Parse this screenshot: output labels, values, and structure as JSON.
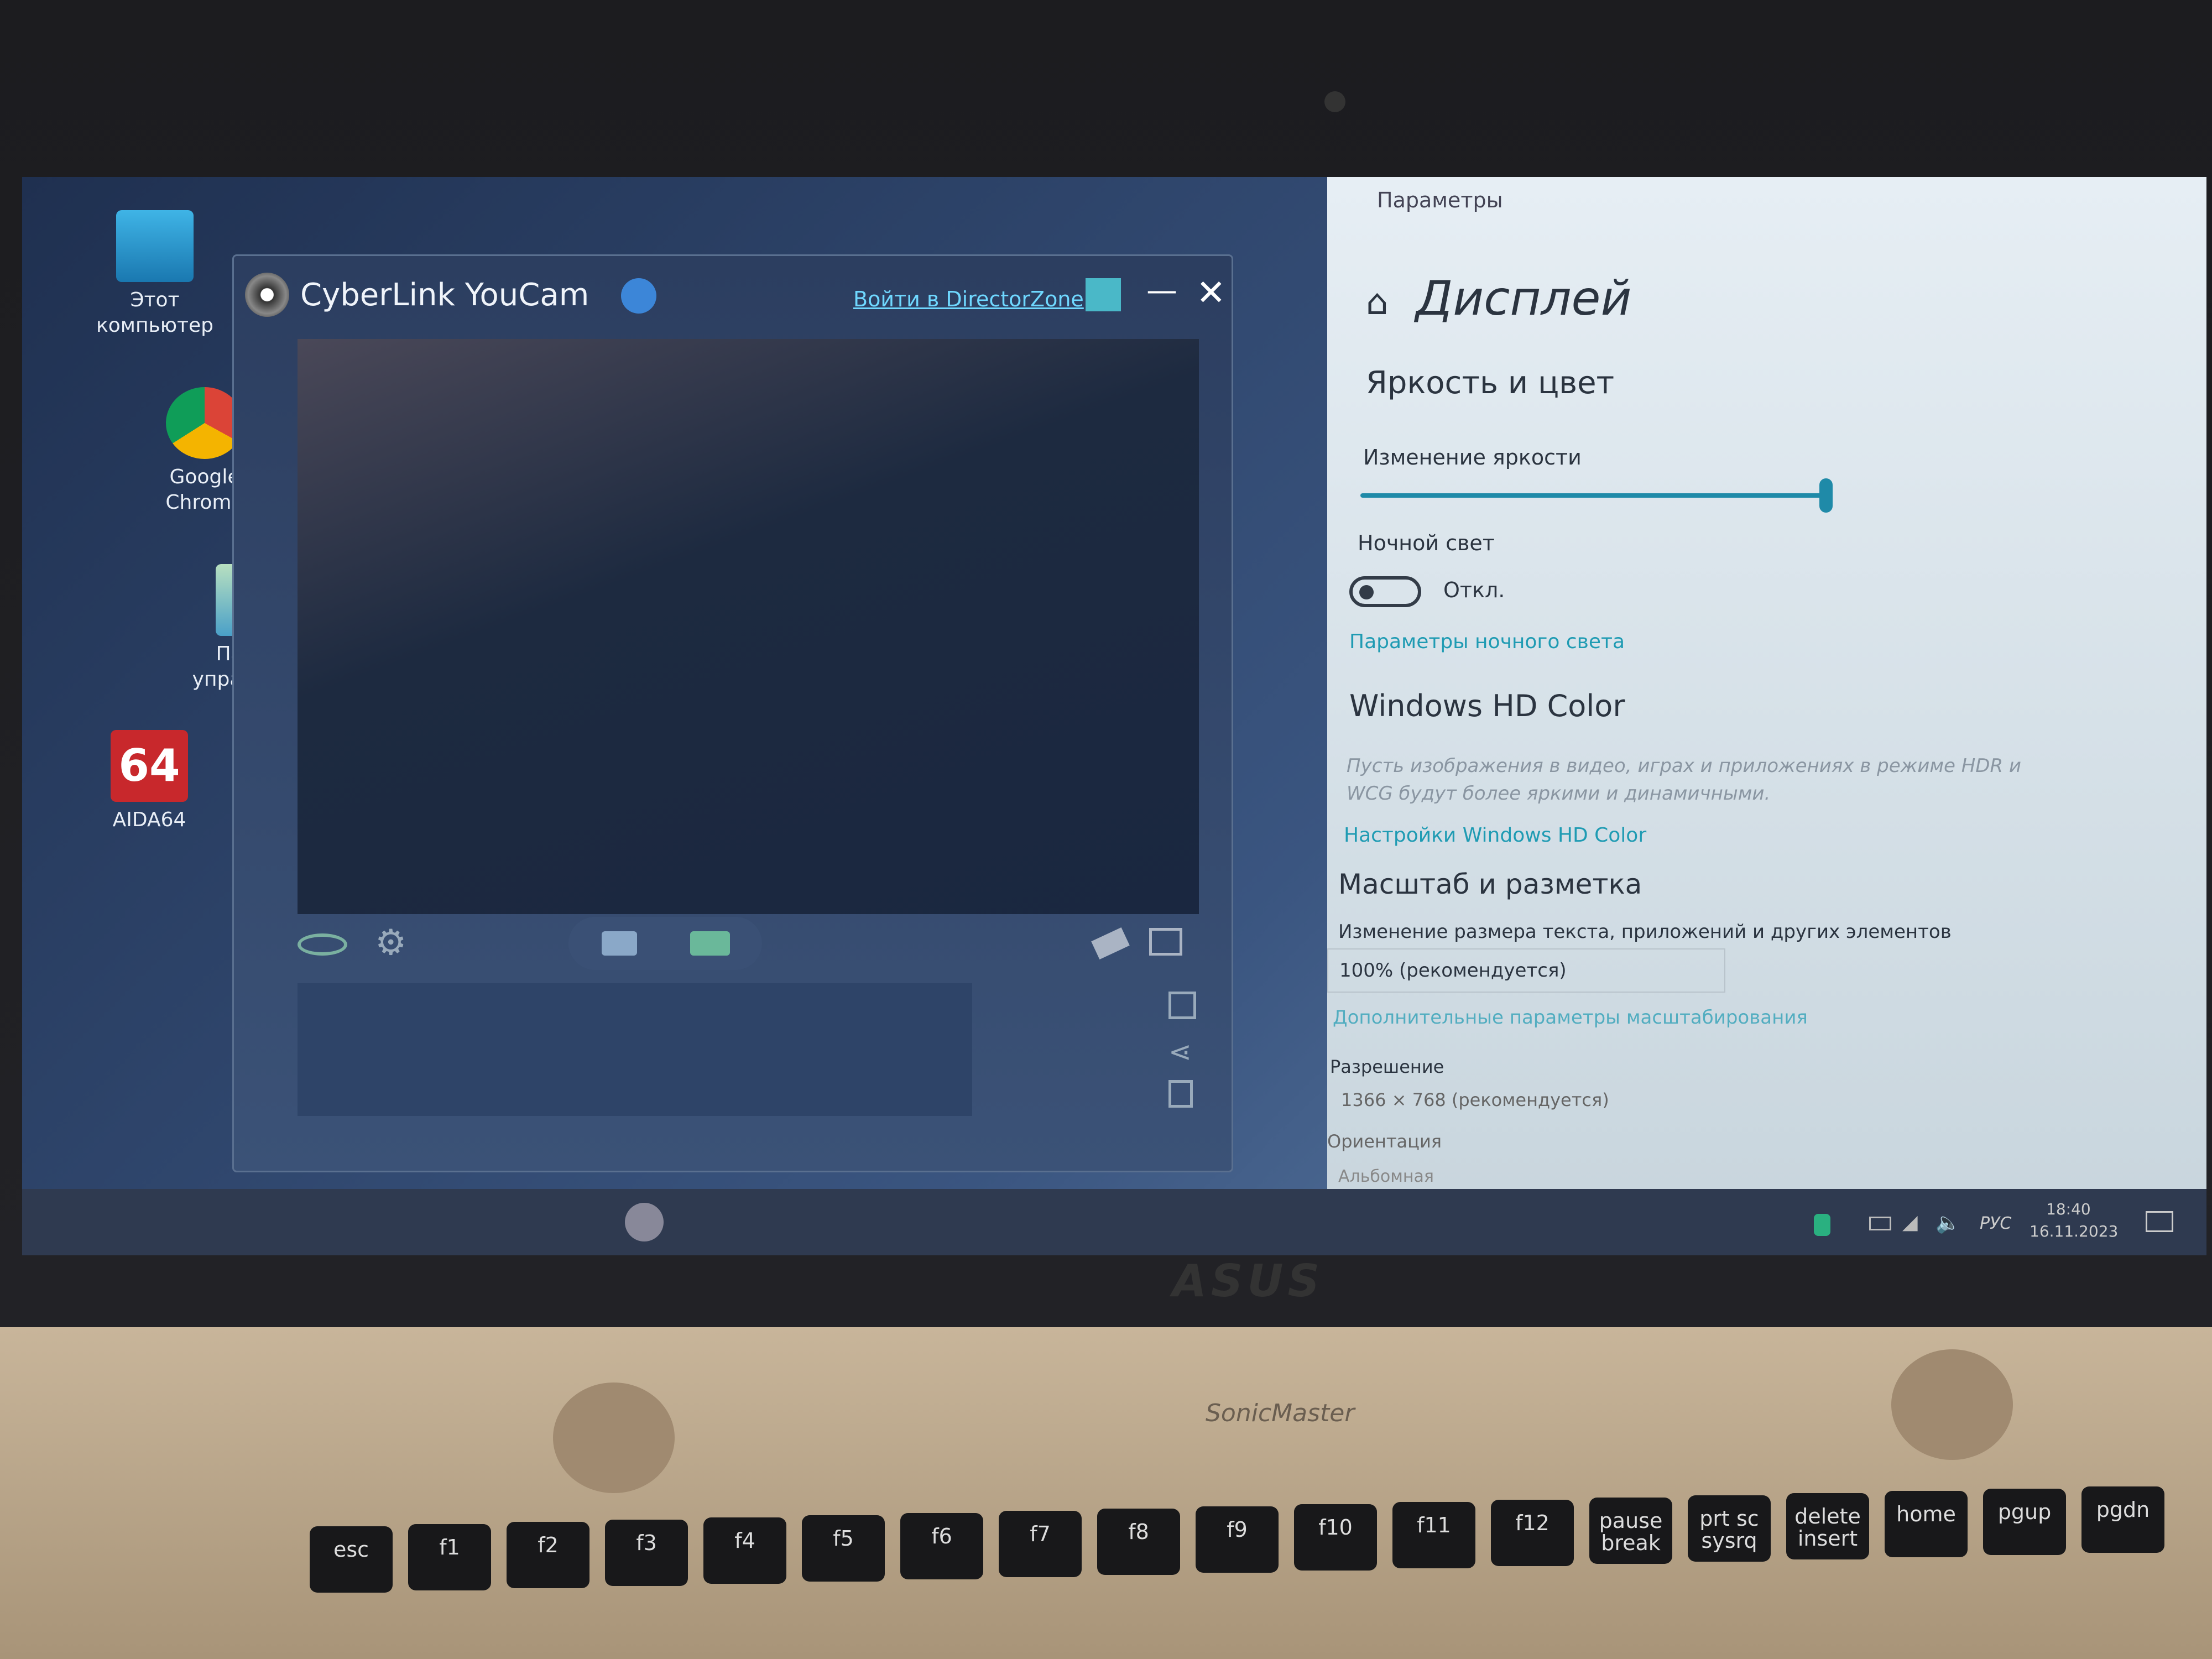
{
  "desktop": {
    "icons": [
      {
        "label": "Этот компьютер",
        "icon": "monitor-icon"
      },
      {
        "label": "Google Chrome",
        "icon": "chrome-icon"
      },
      {
        "label": "Панель управления",
        "icon": "control-panel-icon"
      },
      {
        "label": "AIDA64",
        "icon": "aida64-icon"
      }
    ]
  },
  "youcam": {
    "title": "CyberLink YouCam",
    "login_link": "Войти в DirectorZone",
    "minimize": "—",
    "close": "✕"
  },
  "settings": {
    "window_title": "Параметры",
    "page_title": "Дисплей",
    "brightness_section": "Яркость и цвет",
    "brightness_label": "Изменение яркости",
    "brightness_percent": 100,
    "night_light_label": "Ночной свет",
    "night_light_state": "Откл.",
    "night_light_link": "Параметры ночного света",
    "hdr_title": "Windows HD Color",
    "hdr_desc": "Пусть изображения в видео, играх и приложениях в режиме HDR и WCG будут более яркими и динамичными.",
    "hdr_link": "Настройки Windows HD Color",
    "scale_section": "Масштаб и разметка",
    "scale_label": "Изменение размера текста, приложений и других элементов",
    "scale_value": "100% (рекомендуется)",
    "scale_link": "Дополнительные параметры масштабирования",
    "resolution_label": "Разрешение",
    "resolution_value": "1366 × 768 (рекомендуется)",
    "orientation_label": "Ориентация",
    "orientation_value": "Альбомная",
    "accent": "#1f9bb3"
  },
  "taskbar": {
    "language": "РУС",
    "time": "18:40",
    "date": "16.11.2023"
  },
  "laptop": {
    "brand": "ASUS",
    "speaker": "SonicMaster"
  },
  "keyboard": {
    "keys": [
      "esc",
      "f1",
      "f2",
      "f3",
      "f4",
      "f5",
      "f6",
      "f7",
      "f8",
      "f9",
      "f10",
      "f11",
      "f12",
      "pause break",
      "prt sc sysrq",
      "delete insert",
      "home",
      "pgup",
      "pgdn"
    ]
  }
}
